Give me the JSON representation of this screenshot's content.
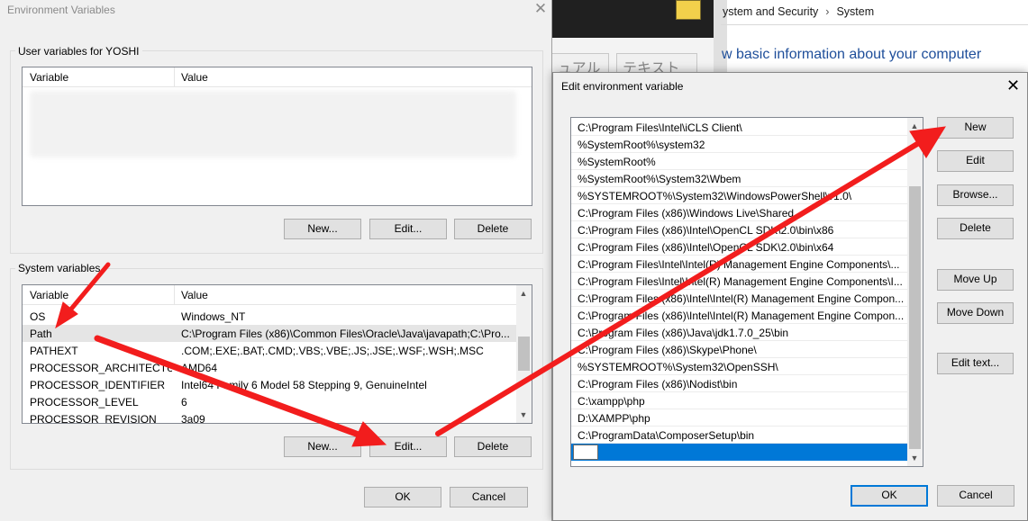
{
  "background_window": {
    "tab_left": "ュアル",
    "tab_right": "テキスト",
    "breadcrumb": [
      "ystem and Security",
      "System"
    ],
    "heading": "w basic information about your computer"
  },
  "env_dialog": {
    "title": "Environment Variables",
    "user_group_label": "User variables for YOSHI",
    "user_columns": [
      "Variable",
      "Value"
    ],
    "user_buttons": {
      "new": "New...",
      "edit": "Edit...",
      "delete": "Delete"
    },
    "system_group_label": "System variables",
    "system_columns": [
      "Variable",
      "Value"
    ],
    "system_rows": [
      {
        "name": "OS",
        "value": "Windows_NT"
      },
      {
        "name": "Path",
        "value": "C:\\Program Files (x86)\\Common Files\\Oracle\\Java\\javapath;C:\\Pro..."
      },
      {
        "name": "PATHEXT",
        "value": ".COM;.EXE;.BAT;.CMD;.VBS;.VBE;.JS;.JSE;.WSF;.WSH;.MSC"
      },
      {
        "name": "PROCESSOR_ARCHITECTURE",
        "value": "AMD64"
      },
      {
        "name": "PROCESSOR_IDENTIFIER",
        "value": "Intel64 Family 6 Model 58 Stepping 9, GenuineIntel"
      },
      {
        "name": "PROCESSOR_LEVEL",
        "value": "6"
      },
      {
        "name": "PROCESSOR_REVISION",
        "value": "3a09"
      }
    ],
    "selected_system_row": "Path",
    "system_buttons": {
      "new": "New...",
      "edit": "Edit...",
      "delete": "Delete"
    },
    "ok": "OK",
    "cancel": "Cancel"
  },
  "edit_dialog": {
    "title": "Edit environment variable",
    "paths": [
      "C:\\Program Files\\Intel\\iCLS Client\\",
      "%SystemRoot%\\system32",
      "%SystemRoot%",
      "%SystemRoot%\\System32\\Wbem",
      "%SYSTEMROOT%\\System32\\WindowsPowerShell\\v1.0\\",
      "C:\\Program Files (x86)\\Windows Live\\Shared",
      "C:\\Program Files (x86)\\Intel\\OpenCL SDK\\2.0\\bin\\x86",
      "C:\\Program Files (x86)\\Intel\\OpenCL SDK\\2.0\\bin\\x64",
      "C:\\Program Files\\Intel\\Intel(R) Management Engine Components\\...",
      "C:\\Program Files\\Intel\\Intel(R) Management Engine Components\\I...",
      "C:\\Program Files (x86)\\Intel\\Intel(R) Management Engine Compon...",
      "C:\\Program Files (x86)\\Intel\\Intel(R) Management Engine Compon...",
      "C:\\Program Files (x86)\\Java\\jdk1.7.0_25\\bin",
      "C:\\Program Files (x86)\\Skype\\Phone\\",
      "%SYSTEMROOT%\\System32\\OpenSSH\\",
      "C:\\Program Files (x86)\\Nodist\\bin",
      "C:\\xampp\\php",
      "D:\\XAMPP\\php",
      "C:\\ProgramData\\ComposerSetup\\bin",
      ""
    ],
    "buttons": {
      "new": "New",
      "edit": "Edit",
      "browse": "Browse...",
      "delete": "Delete",
      "move_up": "Move Up",
      "move_down": "Move Down",
      "edit_text": "Edit text..."
    },
    "ok": "OK",
    "cancel": "Cancel"
  },
  "colors": {
    "selection_blue": "#0078d7",
    "arrow_red": "#f21d1d",
    "dialog_bg": "#f0f0f0"
  }
}
